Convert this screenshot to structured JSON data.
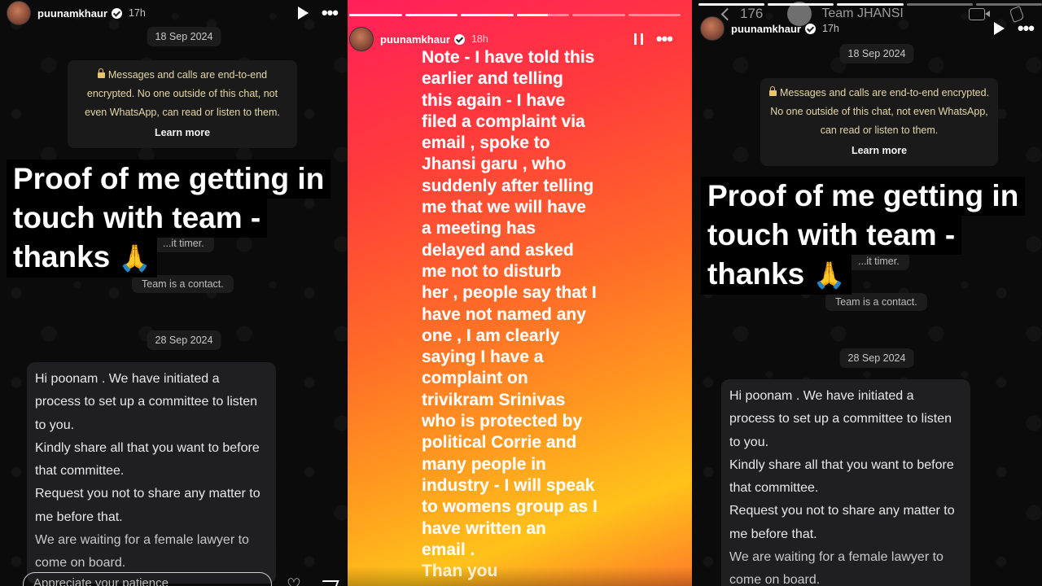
{
  "story_user": {
    "username": "puunamkhaur",
    "left_time": "17h",
    "middle_time": "18h",
    "right_time": "17h"
  },
  "whatsapp": {
    "back_count": "176",
    "contact_name": "Team JHANSI",
    "date1": "18 Sep 2024",
    "date2": "28 Sep 2024",
    "encryption_text": "Messages and calls are end-to-end encrypted. No one outside of this chat, not even WhatsApp, can read or listen to them.",
    "learn_more": "Learn more",
    "sys_timer": "...it timer.",
    "sys_contact": "Team is a contact.",
    "message": {
      "line1": "Hi poonam . We have initiated a process to set up a committee to listen to you.",
      "line2": "Kindly share all that you want to before that committee.",
      "line3": "Request you not to share any matter to me before that.",
      "line4": "We are waiting for a female lawyer to come on board."
    }
  },
  "overlay": {
    "line1": "Proof of me getting in",
    "line2": "touch with team -",
    "line3": "thanks",
    "emoji": "🙏"
  },
  "middle_story": {
    "note": "Note - I have told this\nearlier and telling\nthis again - I have\nfiled a complaint via\nemail , spoke to\nJhansi garu , who\nsuddenly after telling\nme that we will have\na meeting has\ndelayed and asked\nme not to disturb\nher , people say that I\nhave not named any\none , I am clearly\nsaying I have a\ncomplaint  on\ntrivikram Srinivas\nwho is protected by\npolitical  Corrie and\nmany people in\nindustry - I will speak\nto womens group as I\nhave written an\nemail .",
    "sign_off": "Than you",
    "progress": [
      1,
      1,
      1,
      0.6,
      0,
      0
    ]
  },
  "reply": {
    "placeholder": "Appreciate your patience"
  },
  "icons": {
    "play": "play-icon",
    "pause": "pause-icon",
    "more": "more-icon",
    "heart": "heart-icon",
    "send": "send-icon",
    "lock": "lock-icon",
    "back": "back-icon",
    "video": "video-icon",
    "phone": "phone-icon"
  }
}
